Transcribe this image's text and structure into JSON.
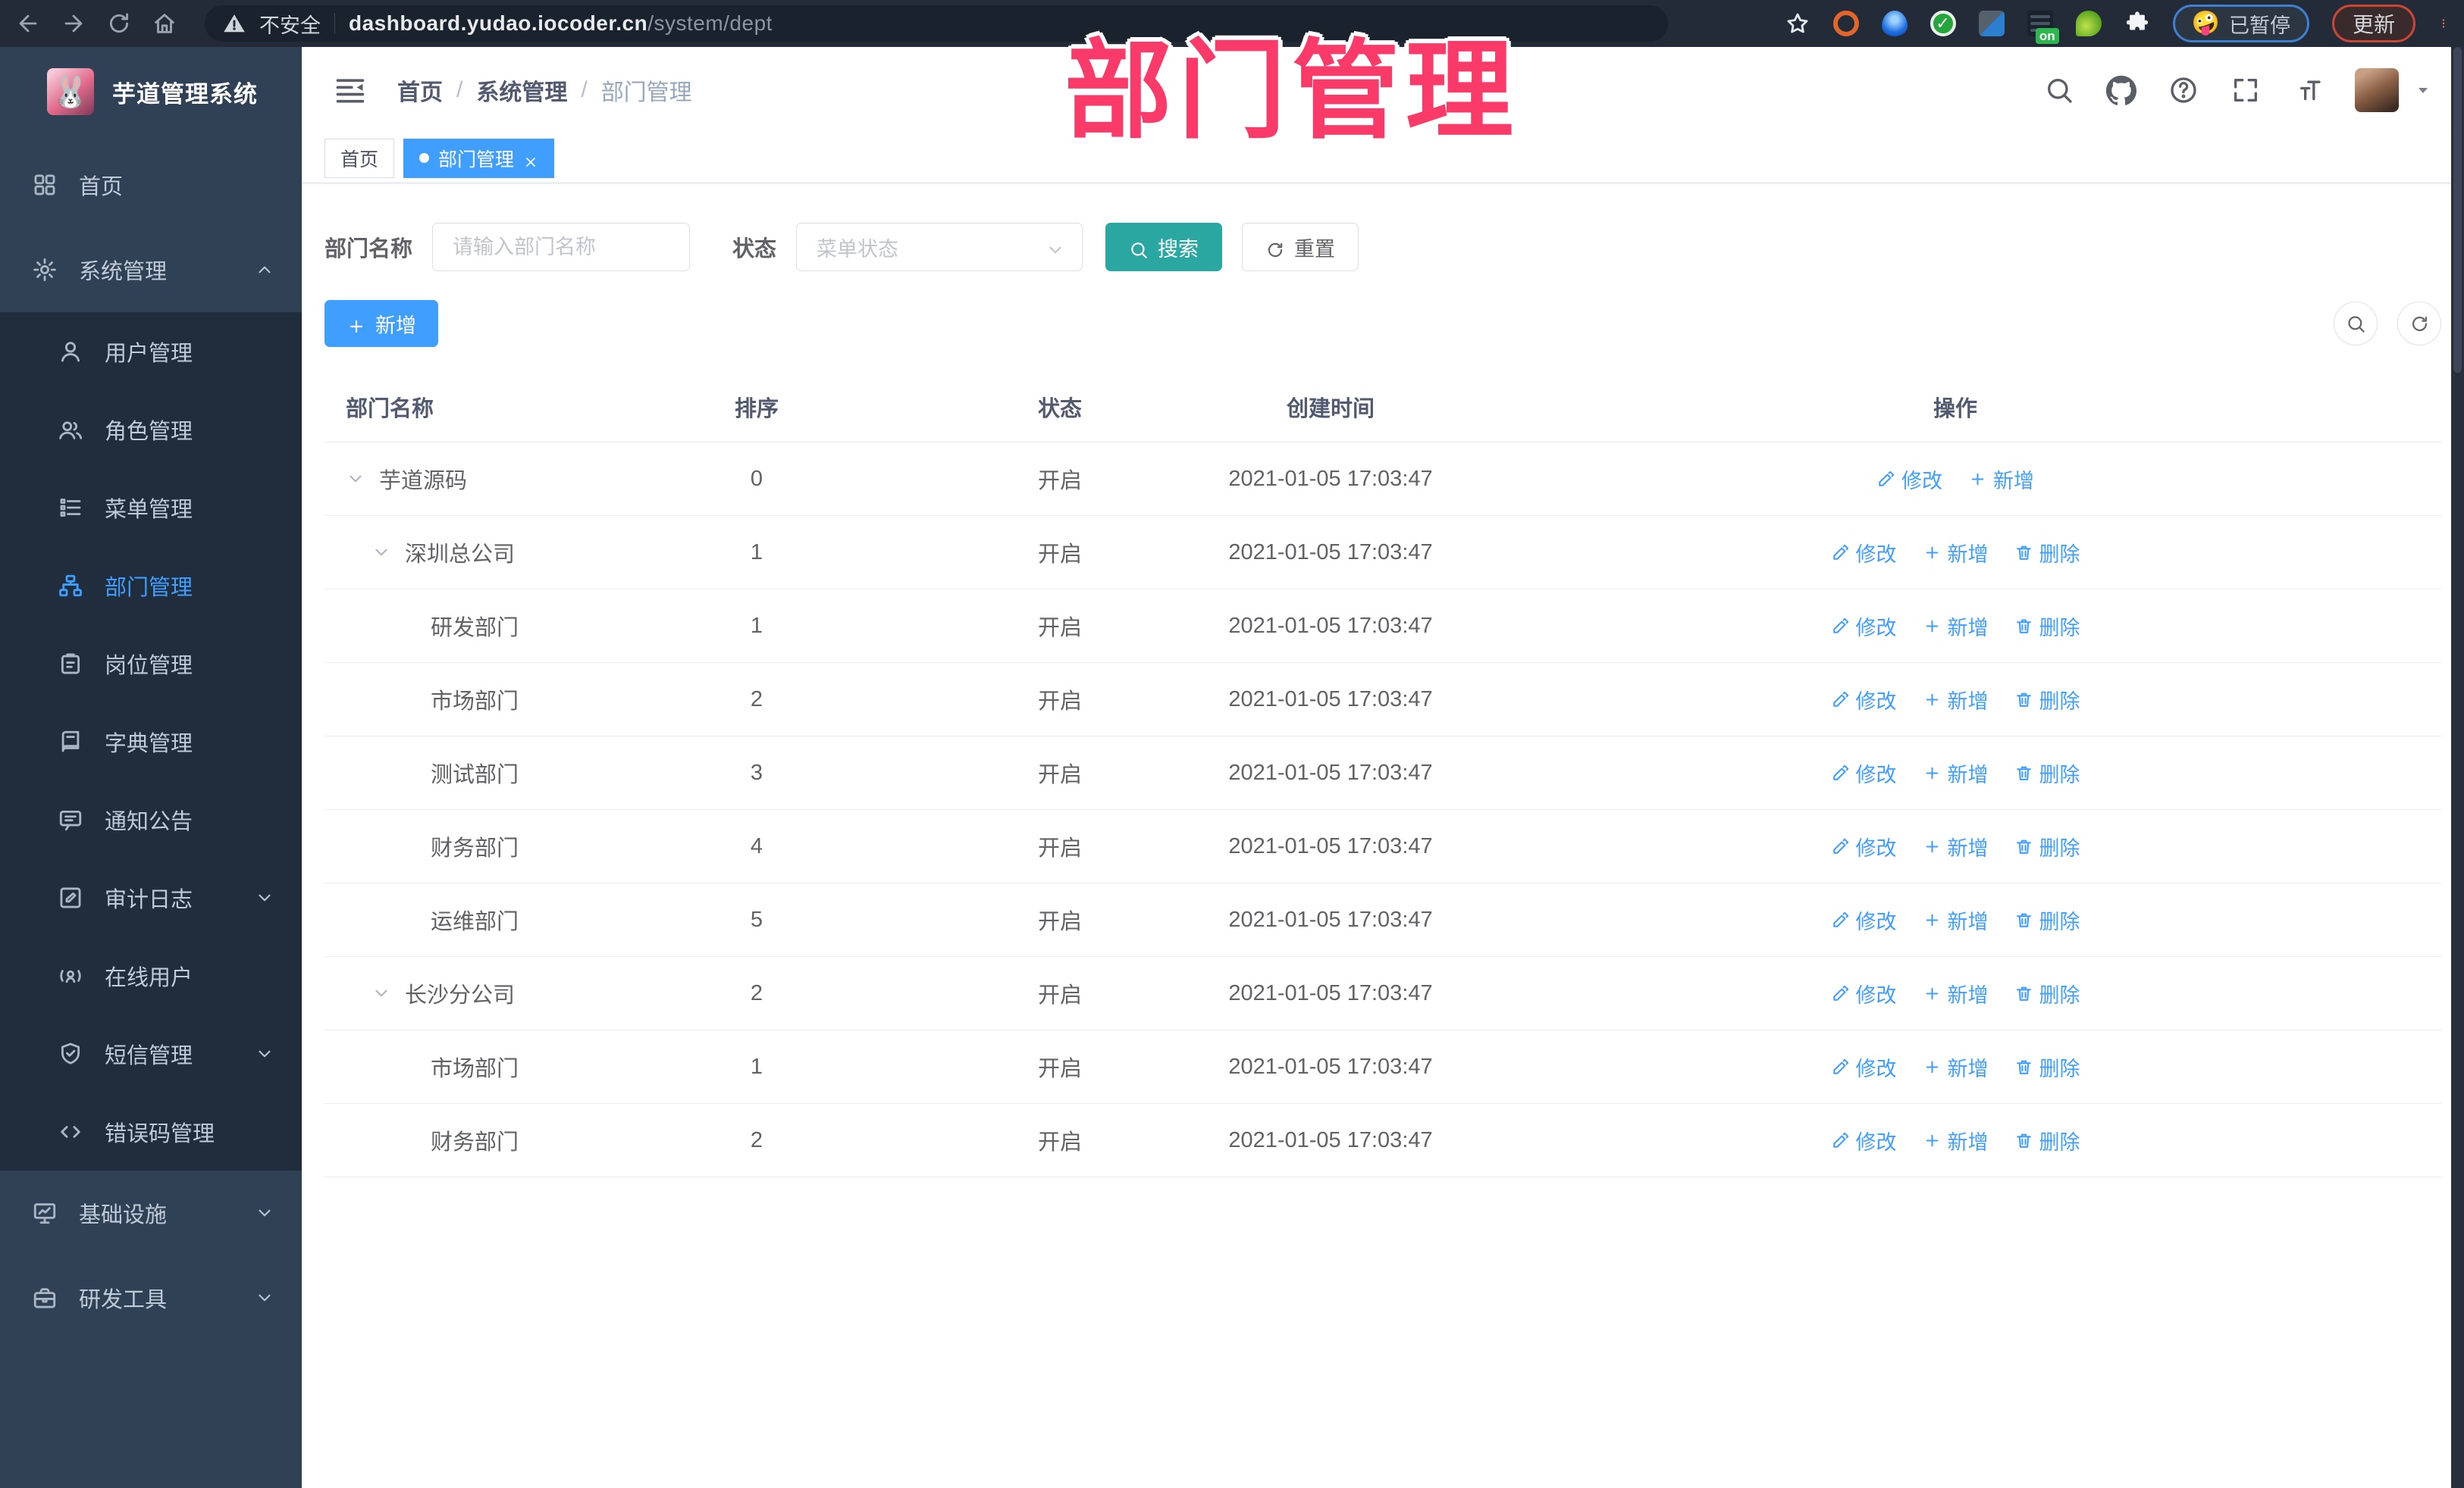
{
  "browser": {
    "security_label": "不安全",
    "url_host": "dashboard.yudao.iocoder.cn",
    "url_path": "/system/dept",
    "ext_badge": "on",
    "paused_emoji": "🤪",
    "paused_badge": "已暂停",
    "update_button": "更新"
  },
  "watermark": "部门管理",
  "sidebar": {
    "app_title": "芋道管理系统",
    "items": [
      {
        "label": "首页",
        "icon": "dashboard-icon",
        "level": "top"
      },
      {
        "label": "系统管理",
        "icon": "gear-icon",
        "level": "top",
        "chevron": "up"
      },
      {
        "label": "用户管理",
        "icon": "user-icon",
        "level": "sub"
      },
      {
        "label": "角色管理",
        "icon": "users-icon",
        "level": "sub"
      },
      {
        "label": "菜单管理",
        "icon": "menu-tree-icon",
        "level": "sub"
      },
      {
        "label": "部门管理",
        "icon": "org-tree-icon",
        "level": "sub",
        "active": true
      },
      {
        "label": "岗位管理",
        "icon": "id-badge-icon",
        "level": "sub"
      },
      {
        "label": "字典管理",
        "icon": "dictionary-icon",
        "level": "sub"
      },
      {
        "label": "通知公告",
        "icon": "announcement-icon",
        "level": "sub"
      },
      {
        "label": "审计日志",
        "icon": "audit-log-icon",
        "level": "sub",
        "chevron": "down"
      },
      {
        "label": "在线用户",
        "icon": "online-user-icon",
        "level": "sub"
      },
      {
        "label": "短信管理",
        "icon": "sms-icon",
        "level": "sub",
        "chevron": "down"
      },
      {
        "label": "错误码管理",
        "icon": "code-icon",
        "level": "sub"
      },
      {
        "label": "基础设施",
        "icon": "infrastructure-icon",
        "level": "top",
        "chevron": "down"
      },
      {
        "label": "研发工具",
        "icon": "dev-tools-icon",
        "level": "top",
        "chevron": "down"
      }
    ]
  },
  "header": {
    "breadcrumbs": [
      "首页",
      "系统管理",
      "部门管理"
    ],
    "breadcrumb_separator": "/"
  },
  "tabs": [
    {
      "label": "首页",
      "active": false
    },
    {
      "label": "部门管理",
      "active": true,
      "closable": true
    }
  ],
  "filters": {
    "name_label": "部门名称",
    "name_placeholder": "请输入部门名称",
    "status_label": "状态",
    "status_placeholder": "菜单状态",
    "search_button": "搜索",
    "reset_button": "重置"
  },
  "toolbar": {
    "add_button": "新增"
  },
  "table": {
    "columns": [
      "部门名称",
      "排序",
      "状态",
      "创建时间",
      "操作"
    ],
    "rows": [
      {
        "name": "芋道源码",
        "level": 1,
        "expandable": true,
        "sort": "0",
        "status": "开启",
        "created": "2021-01-05 17:03:47",
        "actions": [
          {
            "label": "修改",
            "icon": "edit-icon"
          },
          {
            "label": "新增",
            "icon": "plus-icon"
          }
        ]
      },
      {
        "name": "深圳总公司",
        "level": 2,
        "expandable": true,
        "sort": "1",
        "status": "开启",
        "created": "2021-01-05 17:03:47",
        "actions": [
          {
            "label": "修改",
            "icon": "edit-icon"
          },
          {
            "label": "新增",
            "icon": "plus-icon"
          },
          {
            "label": "删除",
            "icon": "delete-icon"
          }
        ]
      },
      {
        "name": "研发部门",
        "level": 3,
        "expandable": false,
        "sort": "1",
        "status": "开启",
        "created": "2021-01-05 17:03:47",
        "actions": [
          {
            "label": "修改",
            "icon": "edit-icon"
          },
          {
            "label": "新增",
            "icon": "plus-icon"
          },
          {
            "label": "删除",
            "icon": "delete-icon"
          }
        ]
      },
      {
        "name": "市场部门",
        "level": 3,
        "expandable": false,
        "sort": "2",
        "status": "开启",
        "created": "2021-01-05 17:03:47",
        "actions": [
          {
            "label": "修改",
            "icon": "edit-icon"
          },
          {
            "label": "新增",
            "icon": "plus-icon"
          },
          {
            "label": "删除",
            "icon": "delete-icon"
          }
        ]
      },
      {
        "name": "测试部门",
        "level": 3,
        "expandable": false,
        "sort": "3",
        "status": "开启",
        "created": "2021-01-05 17:03:47",
        "actions": [
          {
            "label": "修改",
            "icon": "edit-icon"
          },
          {
            "label": "新增",
            "icon": "plus-icon"
          },
          {
            "label": "删除",
            "icon": "delete-icon"
          }
        ]
      },
      {
        "name": "财务部门",
        "level": 3,
        "expandable": false,
        "sort": "4",
        "status": "开启",
        "created": "2021-01-05 17:03:47",
        "actions": [
          {
            "label": "修改",
            "icon": "edit-icon"
          },
          {
            "label": "新增",
            "icon": "plus-icon"
          },
          {
            "label": "删除",
            "icon": "delete-icon"
          }
        ]
      },
      {
        "name": "运维部门",
        "level": 3,
        "expandable": false,
        "sort": "5",
        "status": "开启",
        "created": "2021-01-05 17:03:47",
        "actions": [
          {
            "label": "修改",
            "icon": "edit-icon"
          },
          {
            "label": "新增",
            "icon": "plus-icon"
          },
          {
            "label": "删除",
            "icon": "delete-icon"
          }
        ]
      },
      {
        "name": "长沙分公司",
        "level": 2,
        "expandable": true,
        "sort": "2",
        "status": "开启",
        "created": "2021-01-05 17:03:47",
        "actions": [
          {
            "label": "修改",
            "icon": "edit-icon"
          },
          {
            "label": "新增",
            "icon": "plus-icon"
          },
          {
            "label": "删除",
            "icon": "delete-icon"
          }
        ]
      },
      {
        "name": "市场部门",
        "level": 3,
        "expandable": false,
        "sort": "1",
        "status": "开启",
        "created": "2021-01-05 17:03:47",
        "actions": [
          {
            "label": "修改",
            "icon": "edit-icon"
          },
          {
            "label": "新增",
            "icon": "plus-icon"
          },
          {
            "label": "删除",
            "icon": "delete-icon"
          }
        ]
      },
      {
        "name": "财务部门",
        "level": 3,
        "expandable": false,
        "sort": "2",
        "status": "开启",
        "created": "2021-01-05 17:03:47",
        "actions": [
          {
            "label": "修改",
            "icon": "edit-icon"
          },
          {
            "label": "新增",
            "icon": "plus-icon"
          },
          {
            "label": "删除",
            "icon": "delete-icon"
          }
        ]
      }
    ]
  },
  "colors": {
    "primary_blue": "#409eff",
    "search_button_teal": "#2aa7a1",
    "watermark_pink": "#fa3a68",
    "sidebar_bg": "#304156",
    "submenu_bg": "#1f2d3d",
    "chrome_bg": "#222b37"
  }
}
